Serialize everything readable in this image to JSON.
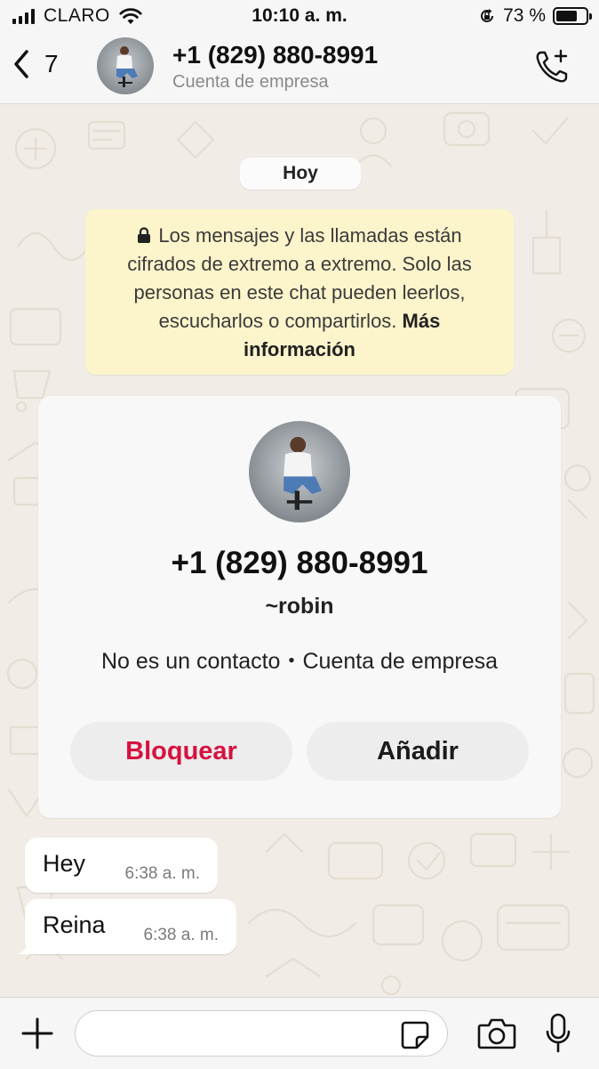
{
  "status_bar": {
    "carrier": "CLARO",
    "time": "10:10 a. m.",
    "battery_text": "73 %",
    "battery_level": 0.73
  },
  "header": {
    "back_count": "7",
    "title": "+1 (829) 880-8991",
    "subtitle": "Cuenta de empresa",
    "icons": {
      "back": "chevron-left-icon",
      "call": "phone-add-icon"
    }
  },
  "chat": {
    "date_chip": "Hoy",
    "encryption_notice": {
      "text": "Los mensajes y las llamadas están cifrados de extremo a extremo. Solo las personas en este chat pueden leerlos, escucharlos o compartirlos.",
      "link": "Más información"
    },
    "contact_card": {
      "phone": "+1 (829) 880-8991",
      "name": "~robin",
      "meta": "No es un contacto・Cuenta de empresa",
      "block_label": "Bloquear",
      "add_label": "Añadir",
      "block_color": "#d6123f"
    },
    "messages": [
      {
        "text": "Hey",
        "time": "6:38 a. m."
      },
      {
        "text": "Reina",
        "time": "6:38 a. m."
      }
    ]
  },
  "input_bar": {
    "placeholder": "",
    "icons": [
      "plus-icon",
      "sticker-icon",
      "camera-icon",
      "microphone-icon"
    ]
  },
  "colors": {
    "wallpaper": "#f1ece5",
    "encryption_bg": "#fcf4cb",
    "bubble_bg": "#ffffff"
  }
}
